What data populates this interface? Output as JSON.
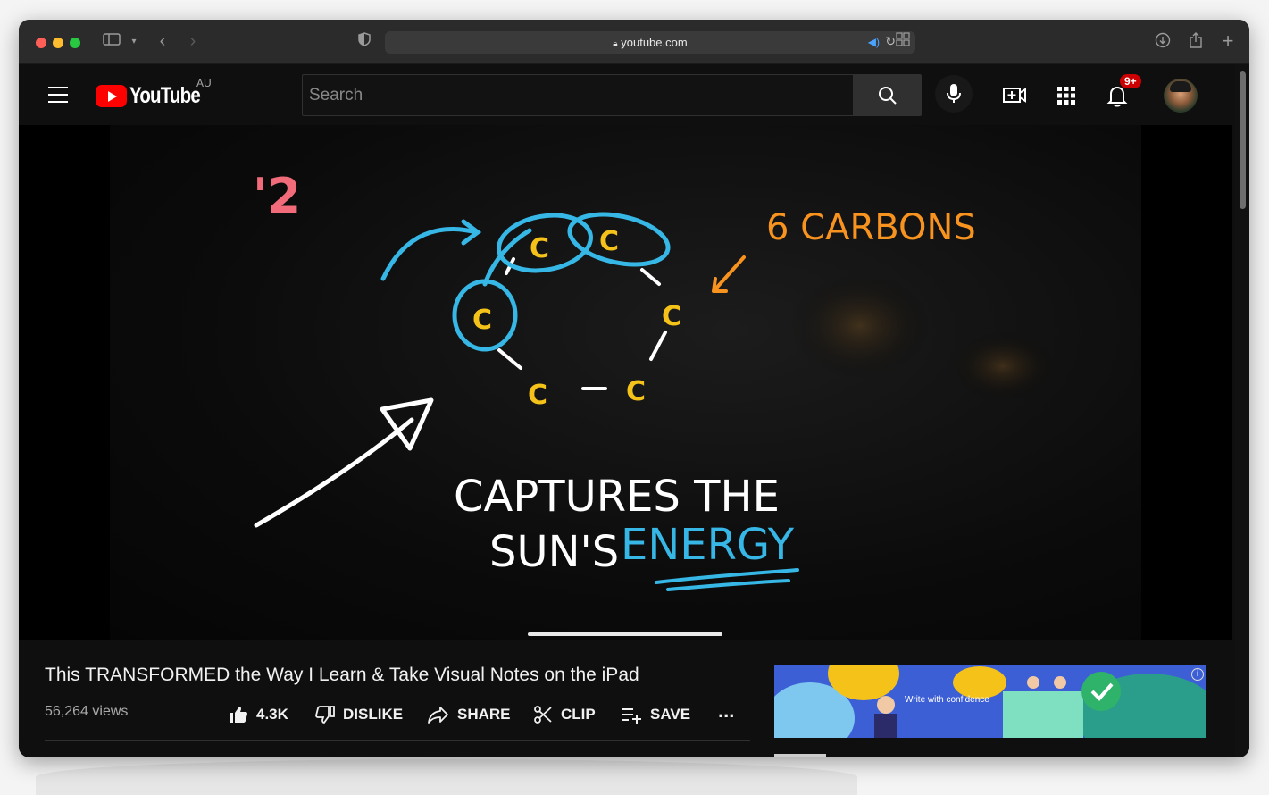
{
  "browser": {
    "url": "youtube.com"
  },
  "header": {
    "logo": "YouTube",
    "country_code": "AU",
    "search_placeholder": "Search",
    "notification_count": "9+"
  },
  "video_overlay": {
    "marker": "'2",
    "carbons_label": "6 CARBONS",
    "carbon_letter": "C",
    "caption_line1": "CAPTURES THE",
    "caption_line2_prefix": "SUN'S",
    "caption_line2_accent": "ENERGY"
  },
  "video": {
    "title": "This TRANSFORMED the Way I Learn & Take Visual Notes on the iPad",
    "views": "56,264 views"
  },
  "actions": {
    "like": "4.3K",
    "dislike": "DISLIKE",
    "share": "SHARE",
    "clip": "CLIP",
    "save": "SAVE",
    "more": "..."
  },
  "ad": {
    "text": "Write with confidence"
  },
  "colors": {
    "annotation_blue": "#36b7e6",
    "annotation_orange": "#f7931e",
    "annotation_yellow": "#f5c21a",
    "annotation_pink": "#f26b7a",
    "youtube_red": "#ff0000"
  }
}
